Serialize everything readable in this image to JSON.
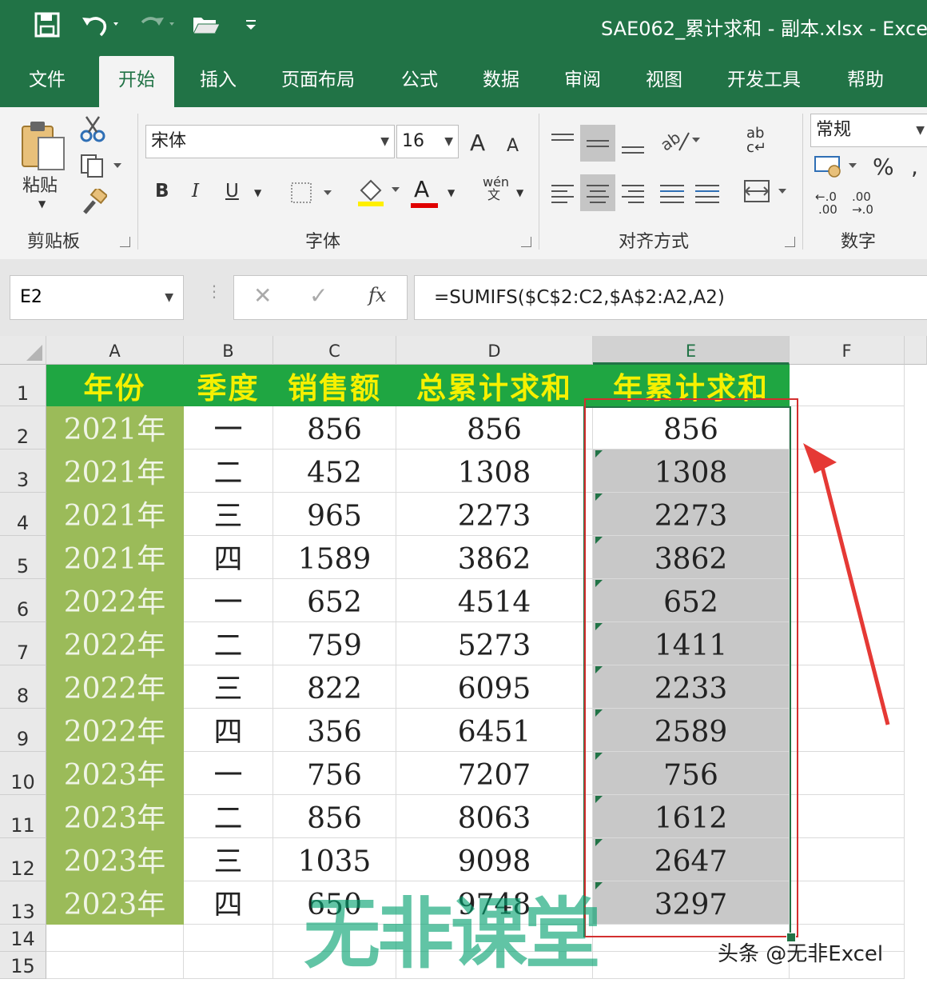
{
  "window": {
    "title": "SAE062_累计求和 - 副本.xlsx  -  Exce"
  },
  "quick_access": {
    "save_icon": "save-icon",
    "undo_icon": "undo-icon",
    "redo_icon": "redo-icon",
    "open_icon": "open-folder-icon",
    "customize_icon": "customize-icon"
  },
  "tabs": [
    "文件",
    "开始",
    "插入",
    "页面布局",
    "公式",
    "数据",
    "审阅",
    "视图",
    "开发工具",
    "帮助"
  ],
  "active_tab": "开始",
  "ribbon": {
    "clipboard": {
      "paste_label": "粘贴",
      "group_label": "剪贴板"
    },
    "font": {
      "font_name": "宋体",
      "font_size": "16",
      "bold": "B",
      "italic": "I",
      "underline": "U",
      "grow": "A",
      "shrink": "A",
      "font_color_glyph": "A",
      "phonetic_top": "wén",
      "phonetic_bottom": "文",
      "group_label": "字体"
    },
    "alignment": {
      "wrap_top": "ab",
      "wrap_bottom": "c↵",
      "group_label": "对齐方式"
    },
    "number": {
      "format": "常规",
      "percent": "%",
      "comma": ",",
      "inc_top": "←.0",
      "inc_bottom": ".00",
      "dec_top": ".00",
      "dec_bottom": "→.0",
      "group_label": "数字"
    }
  },
  "formula_bar": {
    "name_box": "E2",
    "formula": "=SUMIFS($C$2:C2,$A$2:A2,A2)",
    "fx": "fx"
  },
  "columns": [
    "A",
    "B",
    "C",
    "D",
    "E",
    "F"
  ],
  "rows": [
    "1",
    "2",
    "3",
    "4",
    "5",
    "6",
    "7",
    "8",
    "9",
    "10",
    "11",
    "12",
    "13",
    "14",
    "15"
  ],
  "table": {
    "headers": [
      "年份",
      "季度",
      "销售额",
      "总累计求和",
      "年累计求和"
    ],
    "data": [
      [
        "2021年",
        "一",
        "856",
        "856",
        "856"
      ],
      [
        "2021年",
        "二",
        "452",
        "1308",
        "1308"
      ],
      [
        "2021年",
        "三",
        "965",
        "2273",
        "2273"
      ],
      [
        "2021年",
        "四",
        "1589",
        "3862",
        "3862"
      ],
      [
        "2022年",
        "一",
        "652",
        "4514",
        "652"
      ],
      [
        "2022年",
        "二",
        "759",
        "5273",
        "1411"
      ],
      [
        "2022年",
        "三",
        "822",
        "6095",
        "2233"
      ],
      [
        "2022年",
        "四",
        "356",
        "6451",
        "2589"
      ],
      [
        "2023年",
        "一",
        "756",
        "7207",
        "756"
      ],
      [
        "2023年",
        "二",
        "856",
        "8063",
        "1612"
      ],
      [
        "2023年",
        "三",
        "1035",
        "9098",
        "2647"
      ],
      [
        "2023年",
        "四",
        "650",
        "9748",
        "3297"
      ]
    ]
  },
  "watermark": "无非课堂",
  "credit": "头条 @无非Excel",
  "colors": {
    "excel_green": "#217346",
    "header_fill": "#1fa642",
    "header_text": "#f6f000",
    "year_fill": "#9bbb59",
    "selection_fill": "#c8c8c8",
    "annotation_red": "#d32f2f"
  }
}
